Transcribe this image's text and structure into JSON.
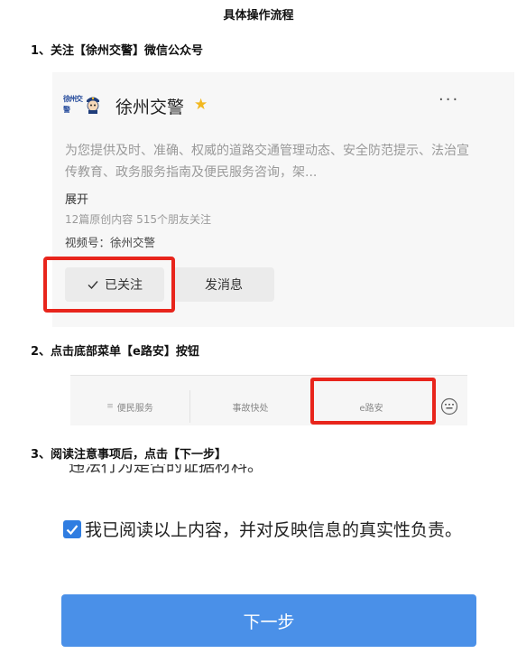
{
  "page": {
    "title": "具体操作流程"
  },
  "steps": [
    {
      "heading": "1、关注【徐州交警】微信公众号"
    },
    {
      "heading": "2、点击底部菜单【e路安】按钮"
    },
    {
      "heading": "3、阅读注意事项后，点击【下一步】"
    }
  ],
  "account_card": {
    "logo_text": "徐州交警",
    "logo_icon": "police-mascot-icon",
    "name": "徐州交警",
    "verified_icon": "star-icon",
    "more_icon": "more-dots-icon",
    "more_glyph": "···",
    "description": "为您提供及时、准确、权威的道路交通管理动态、安全防范提示、法治宣传教育、政务服务指南及便民服务咨询，架...",
    "expand_label": "展开",
    "stats": "12篇原创内容  515个朋友关注",
    "video_channel": "视频号：徐州交警",
    "follow_button": "已关注",
    "message_button": "发消息",
    "highlight_color": "#e8251c"
  },
  "bottom_menu": {
    "items": [
      {
        "label": "便民服务",
        "icon": "menu-lines-icon"
      },
      {
        "label": "事故快处"
      },
      {
        "label": "e路安"
      }
    ],
    "keyboard_icon": "keyboard-icon"
  },
  "agreement": {
    "cut_off_text": "违法行为是否的证据材料。",
    "checkbox_checked": true,
    "text": "我已阅读以上内容，并对反映信息的真实性负责。",
    "next_button": "下一步",
    "accent_color": "#4a90e8"
  }
}
